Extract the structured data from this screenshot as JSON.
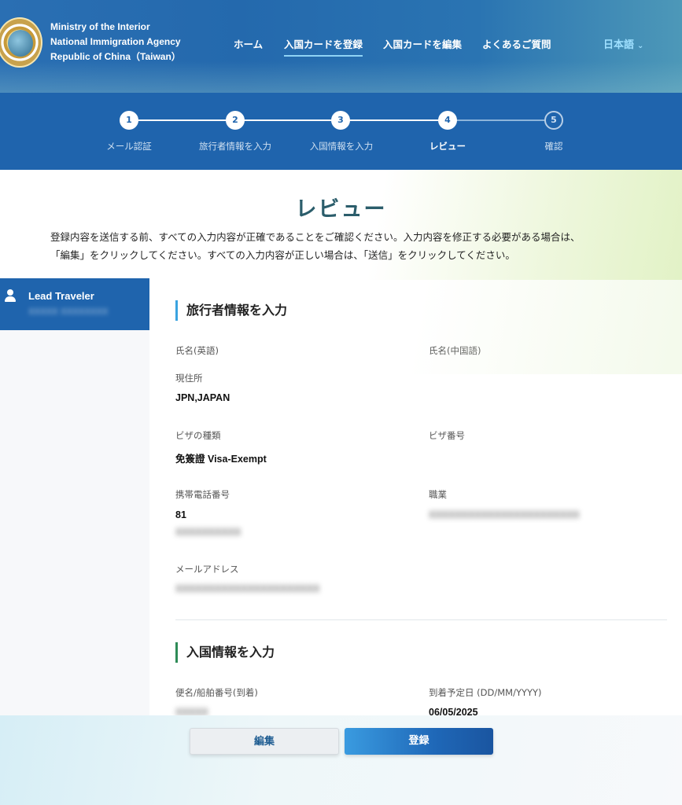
{
  "header": {
    "agency_lines": [
      "Ministry of the Interior",
      "National Immigration Agency",
      "Republic of China（Taiwan）"
    ],
    "nav": [
      {
        "label": "ホーム",
        "active": false
      },
      {
        "label": "入国カードを登録",
        "active": true
      },
      {
        "label": "入国カードを編集",
        "active": false
      },
      {
        "label": "よくあるご質問",
        "active": false
      }
    ],
    "language": "日本語"
  },
  "stepper": {
    "current_step": 4,
    "steps": [
      {
        "number": "1",
        "label": "メール認証"
      },
      {
        "number": "2",
        "label": "旅行者情報を入力"
      },
      {
        "number": "3",
        "label": "入国情報を入力"
      },
      {
        "number": "4",
        "label": "レビュー"
      },
      {
        "number": "5",
        "label": "確認"
      }
    ]
  },
  "intro": {
    "title": "レビュー",
    "lines": [
      "登録内容を送信する前、すべての入力内容が正確であることをご確認ください。入力内容を修正する必要がある場合は、",
      "「編集」をクリックしてください。すべての入力内容が正しい場合は、「送信」をクリックしてください。"
    ]
  },
  "sidebar": {
    "traveler_label": "Lead Traveler",
    "traveler_sub": "XXXXX XXXXXXXX"
  },
  "traveler_section": {
    "title": "旅行者情報を入力",
    "fields": {
      "name_en_label": "氏名(英語)",
      "name_zh_label": "氏名(中国語)",
      "residence_label": "現住所",
      "residence_value": "JPN,JAPAN",
      "visa_type_label": "ビザの種類",
      "visa_type_value": "免簽證 Visa-Exempt",
      "visa_no_label": "ビザ番号",
      "phone_label": "携帯電話番号",
      "phone_code": "81",
      "phone_number": "XXXXXXXXXX",
      "occupation_label": "職業",
      "occupation_value": "XXXXXXXXXXXXXXXXXXXXXXX",
      "email_label": "メールアドレス",
      "email_value": "XXXXXXXXXXXXXXXXXXXXXX"
    }
  },
  "entry_section": {
    "title": "入国情報を入力",
    "fields": {
      "flight_label": "便名/船舶番号(到着)",
      "flight_value": "XXXXX",
      "arrival_label": "到着予定日 (DD/MM/YYYY)",
      "arrival_value": "06/05/2025"
    }
  },
  "buttons": {
    "edit": "編集",
    "submit": "登録"
  },
  "colors": {
    "header_blue": "#2469ad",
    "stepper_blue": "#1f64ad",
    "title_teal": "#2b5d6b",
    "accent_blue": "#3aa3e0",
    "accent_green": "#2e8b57"
  }
}
